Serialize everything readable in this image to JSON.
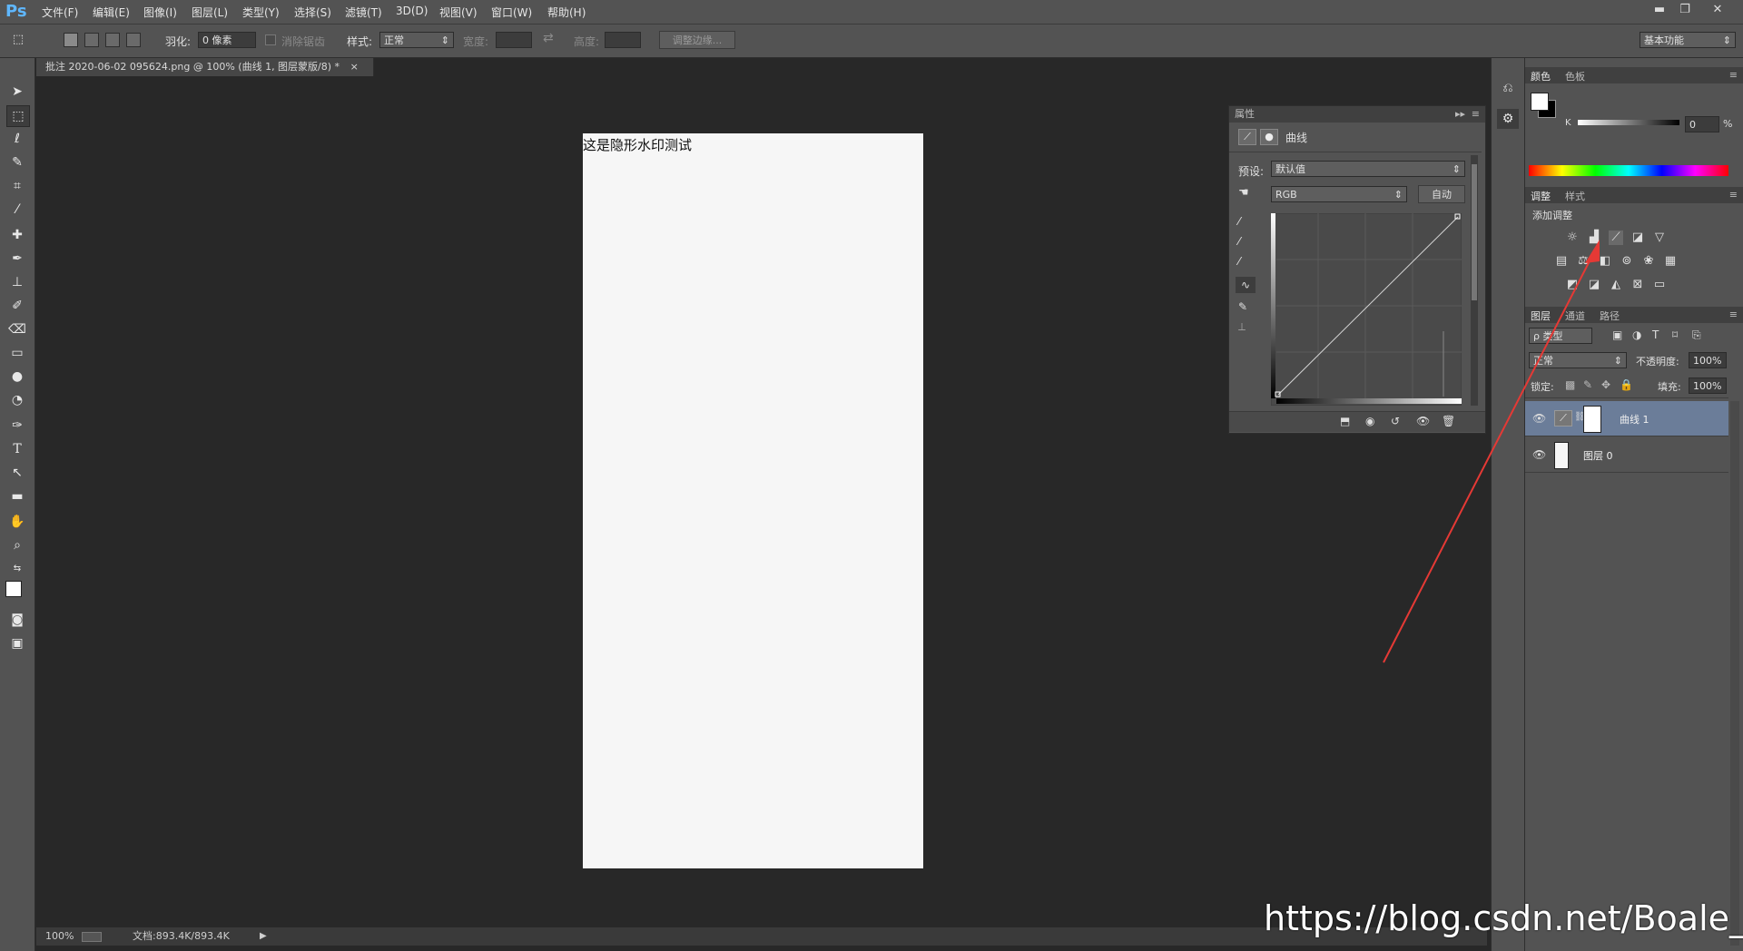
{
  "app": {
    "logo": "Ps"
  },
  "menu": [
    "文件(F)",
    "编辑(E)",
    "图像(I)",
    "图层(L)",
    "类型(Y)",
    "选择(S)",
    "滤镜(T)",
    "3D(D)",
    "视图(V)",
    "窗口(W)",
    "帮助(H)"
  ],
  "window_buttons": {
    "minimize": "▬",
    "restore": "❐",
    "close": "✕"
  },
  "options": {
    "feather_label": "羽化:",
    "feather_value": "0 像素",
    "antialias_label": "消除锯齿",
    "style_label": "样式:",
    "style_value": "正常",
    "width_label": "宽度:",
    "height_label": "高度:",
    "refine_edge": "调整边缘...",
    "workspace": "基本功能"
  },
  "document": {
    "tab_title": "批注 2020-06-02 095624.png @ 100% (曲线 1, 图层蒙版/8) *",
    "close": "×",
    "canvas_text": "这是隐形水印测试"
  },
  "status": {
    "zoom": "100%",
    "doc_size": "文档:893.4K/893.4K"
  },
  "properties": {
    "title": "属性",
    "type_label": "曲线",
    "preset_label": "预设:",
    "preset_value": "默认值",
    "channel_value": "RGB",
    "auto_button": "自动"
  },
  "color_panel": {
    "tabs": [
      "颜色",
      "色板"
    ],
    "k_label": "K",
    "k_value": "0",
    "percent": "%"
  },
  "adjustments_panel": {
    "tabs": [
      "调整",
      "样式"
    ],
    "title": "添加调整"
  },
  "layers_panel": {
    "tabs": [
      "图层",
      "通道",
      "路径"
    ],
    "filter_kind": "ρ 类型",
    "blend_mode": "正常",
    "opacity_label": "不透明度:",
    "opacity_value": "100%",
    "lock_label": "锁定:",
    "fill_label": "填充:",
    "fill_value": "100%",
    "layers": [
      {
        "name": "曲线 1",
        "selected": true
      },
      {
        "name": "图层 0",
        "selected": false
      }
    ]
  },
  "watermark": "https://blog.csdn.net/Boale_H",
  "colors": {
    "ui_bg": "#535353",
    "workspace": "#282828",
    "selected_layer": "#6b7d99",
    "arrow": "#e53935"
  }
}
